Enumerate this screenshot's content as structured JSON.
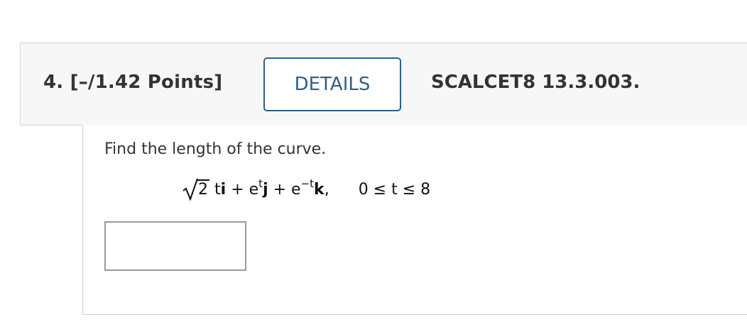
{
  "header": {
    "question_number": "4. [–/1.42 Points]",
    "details_label": "DETAILS",
    "problem_id": "SCALCET8 13.3.003."
  },
  "problem": {
    "prompt": "Find the length of the curve.",
    "formula": {
      "radicand": "2",
      "t_var": "t",
      "i_vec": "i",
      "plus1": "+",
      "e1": "e",
      "exp1": "t",
      "j_vec": "j",
      "plus2": "+",
      "e2": "e",
      "exp2": "−t",
      "k_vec": "k",
      "comma": ",",
      "range": "0 ≤ t ≤ 8"
    },
    "answer_value": ""
  }
}
